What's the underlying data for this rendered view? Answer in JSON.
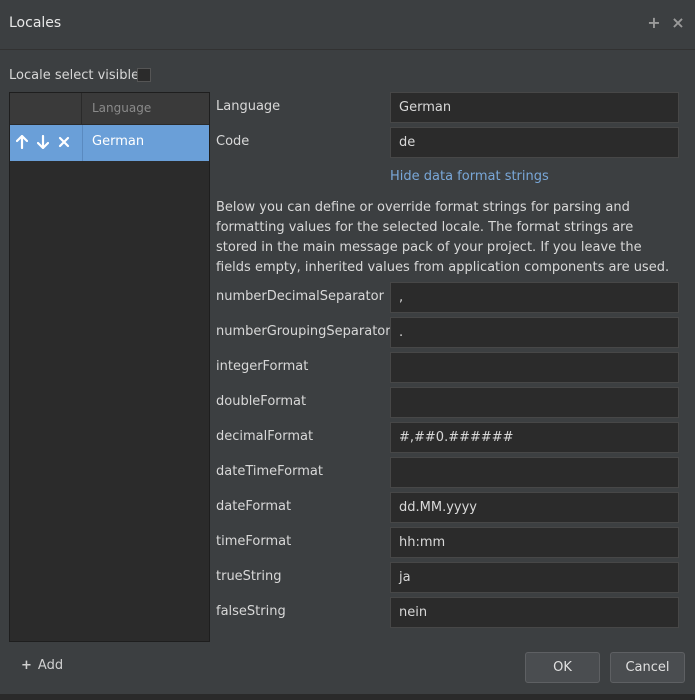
{
  "dialog": {
    "title": "Locales",
    "add_icon": "plus-icon",
    "close_icon": "close-icon"
  },
  "locale_select_visible": {
    "label": "Locale select visible",
    "checked": false
  },
  "list": {
    "header_language": "Language",
    "rows": [
      {
        "language": "German",
        "selected": true
      }
    ],
    "row_icons": [
      "arrow-up-icon",
      "arrow-down-icon",
      "delete-icon"
    ]
  },
  "form": {
    "language_label": "Language",
    "language_value": "German",
    "code_label": "Code",
    "code_value": "de",
    "toggle_link": "Hide data format strings",
    "description": "Below you can define or override format strings for parsing and formatting values for the selected locale. The format strings are stored in the main message pack of your project. If you leave the fields empty, inherited values from application components are used.",
    "fields": [
      {
        "label": "numberDecimalSeparator",
        "value": ","
      },
      {
        "label": "numberGroupingSeparator",
        "value": "."
      },
      {
        "label": "integerFormat",
        "value": ""
      },
      {
        "label": "doubleFormat",
        "value": ""
      },
      {
        "label": "decimalFormat",
        "value": "#,##0.######"
      },
      {
        "label": "dateTimeFormat",
        "value": ""
      },
      {
        "label": "dateFormat",
        "value": "dd.MM.yyyy"
      },
      {
        "label": "timeFormat",
        "value": "hh:mm"
      },
      {
        "label": "trueString",
        "value": "ja"
      },
      {
        "label": "falseString",
        "value": "nein"
      }
    ]
  },
  "footer": {
    "add_label": "Add",
    "ok_label": "OK",
    "cancel_label": "Cancel"
  },
  "colors": {
    "background": "#3c3f41",
    "selection": "#6a9fd8",
    "link": "#79a7d8"
  }
}
